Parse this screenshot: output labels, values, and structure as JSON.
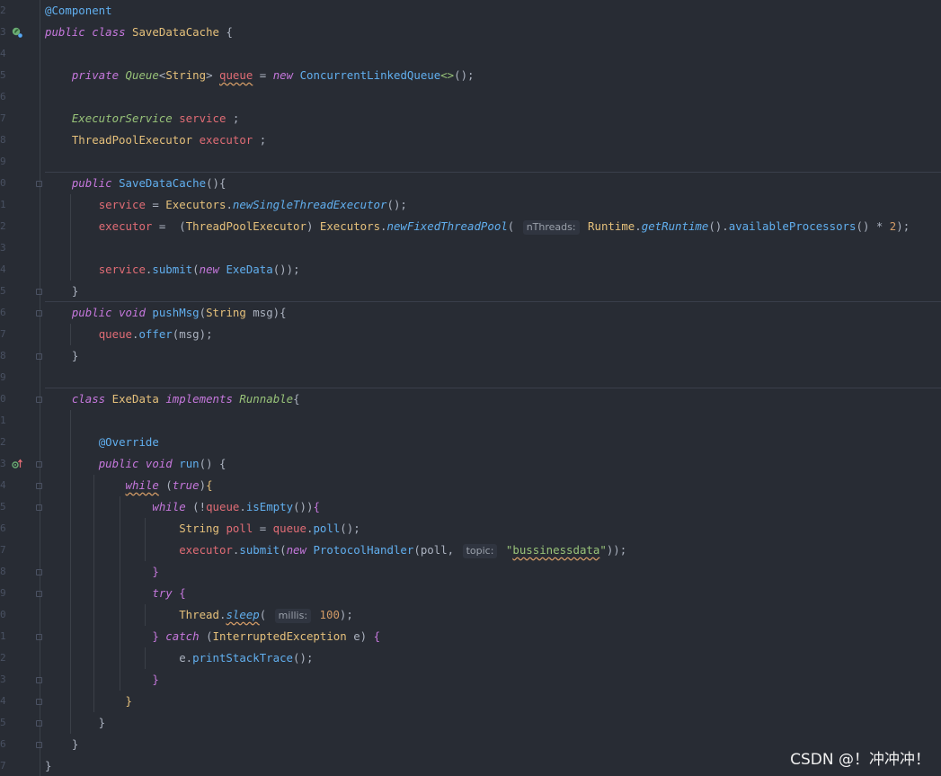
{
  "editor": {
    "line_numbers": [
      "2",
      "3",
      "4",
      "5",
      "6",
      "7",
      "8",
      "9",
      "0",
      "1",
      "2",
      "3",
      "4",
      "5",
      "6",
      "7",
      "8",
      "9",
      "0",
      "1",
      "2",
      "3",
      "4",
      "5",
      "6",
      "7",
      "8",
      "9",
      "0",
      "1",
      "2",
      "3",
      "4",
      "5",
      "6",
      "7"
    ],
    "lines": [
      [
        {
          "t": "@Component",
          "c": "ann"
        }
      ],
      [
        {
          "t": "public",
          "c": "kw"
        },
        {
          "t": " "
        },
        {
          "t": "class",
          "c": "kw"
        },
        {
          "t": " "
        },
        {
          "t": "SaveDataCache",
          "c": "cls"
        },
        {
          "t": " "
        },
        {
          "t": "{",
          "c": "punc"
        }
      ],
      [],
      [
        {
          "t": "    "
        },
        {
          "t": "private",
          "c": "kw"
        },
        {
          "t": " "
        },
        {
          "t": "Queue",
          "c": "itype"
        },
        {
          "t": "<"
        },
        {
          "t": "String",
          "c": "cls"
        },
        {
          "t": "> "
        },
        {
          "t": "queue",
          "c": "fldw"
        },
        {
          "t": " = "
        },
        {
          "t": "new",
          "c": "kw"
        },
        {
          "t": " "
        },
        {
          "t": "ConcurrentLinkedQueue",
          "c": "fn"
        },
        {
          "t": "<>",
          "c": "str"
        },
        {
          "t": "();"
        }
      ],
      [],
      [
        {
          "t": "    "
        },
        {
          "t": "ExecutorService",
          "c": "itype"
        },
        {
          "t": " "
        },
        {
          "t": "service",
          "c": "fld"
        },
        {
          "t": " ;"
        }
      ],
      [
        {
          "t": "    "
        },
        {
          "t": "ThreadPoolExecutor",
          "c": "cls"
        },
        {
          "t": " "
        },
        {
          "t": "executor",
          "c": "fld"
        },
        {
          "t": " ;"
        }
      ],
      [],
      [
        {
          "t": "    "
        },
        {
          "t": "public",
          "c": "kw"
        },
        {
          "t": " "
        },
        {
          "t": "SaveDataCache",
          "c": "fn"
        },
        {
          "t": "(){"
        }
      ],
      [
        {
          "t": "        "
        },
        {
          "t": "service",
          "c": "fld"
        },
        {
          "t": " = "
        },
        {
          "t": "Executors",
          "c": "cls"
        },
        {
          "t": "."
        },
        {
          "t": "newSingleThreadExecutor",
          "c": "sfn"
        },
        {
          "t": "();"
        }
      ],
      [
        {
          "t": "        "
        },
        {
          "t": "executor",
          "c": "fld"
        },
        {
          "t": " =  ("
        },
        {
          "t": "ThreadPoolExecutor",
          "c": "cls"
        },
        {
          "t": ") "
        },
        {
          "t": "Executors",
          "c": "cls"
        },
        {
          "t": "."
        },
        {
          "t": "newFixedThreadPool",
          "c": "sfn"
        },
        {
          "t": "( "
        },
        {
          "t": "nThreads:",
          "h": 1
        },
        {
          "t": " "
        },
        {
          "t": "Runtime",
          "c": "cls"
        },
        {
          "t": "."
        },
        {
          "t": "getRuntime",
          "c": "sfn"
        },
        {
          "t": "()."
        },
        {
          "t": "availableProcessors",
          "c": "fn"
        },
        {
          "t": "() * "
        },
        {
          "t": "2",
          "c": "num"
        },
        {
          "t": ");"
        }
      ],
      [],
      [
        {
          "t": "        "
        },
        {
          "t": "service",
          "c": "fld"
        },
        {
          "t": "."
        },
        {
          "t": "submit",
          "c": "fn"
        },
        {
          "t": "("
        },
        {
          "t": "new",
          "c": "kw"
        },
        {
          "t": " "
        },
        {
          "t": "ExeData",
          "c": "fn"
        },
        {
          "t": "());"
        }
      ],
      [
        {
          "t": "    }"
        }
      ],
      [
        {
          "t": "    "
        },
        {
          "t": "public",
          "c": "kw"
        },
        {
          "t": " "
        },
        {
          "t": "void",
          "c": "kw"
        },
        {
          "t": " "
        },
        {
          "t": "pushMsg",
          "c": "fn"
        },
        {
          "t": "("
        },
        {
          "t": "String",
          "c": "cls"
        },
        {
          "t": " msg){"
        }
      ],
      [
        {
          "t": "        "
        },
        {
          "t": "queue",
          "c": "fld"
        },
        {
          "t": "."
        },
        {
          "t": "offer",
          "c": "fn"
        },
        {
          "t": "(msg);"
        }
      ],
      [
        {
          "t": "    }"
        }
      ],
      [],
      [
        {
          "t": "    "
        },
        {
          "t": "class",
          "c": "kw"
        },
        {
          "t": " "
        },
        {
          "t": "ExeData",
          "c": "cls"
        },
        {
          "t": " "
        },
        {
          "t": "implements",
          "c": "kw"
        },
        {
          "t": " "
        },
        {
          "t": "Runnable",
          "c": "itype"
        },
        {
          "t": "{"
        }
      ],
      [],
      [
        {
          "t": "        "
        },
        {
          "t": "@Override",
          "c": "ann"
        }
      ],
      [
        {
          "t": "        "
        },
        {
          "t": "public",
          "c": "kw"
        },
        {
          "t": " "
        },
        {
          "t": "void",
          "c": "kw"
        },
        {
          "t": " "
        },
        {
          "t": "run",
          "c": "fn"
        },
        {
          "t": "() {"
        }
      ],
      [
        {
          "t": "            "
        },
        {
          "t": "while",
          "c": "kw wavy"
        },
        {
          "t": " ("
        },
        {
          "t": "true",
          "c": "kw"
        },
        {
          "t": ")"
        },
        {
          "t": "{",
          "c": "br1"
        }
      ],
      [
        {
          "t": "                "
        },
        {
          "t": "while",
          "c": "kw"
        },
        {
          "t": " (!"
        },
        {
          "t": "queue",
          "c": "fld"
        },
        {
          "t": "."
        },
        {
          "t": "isEmpty",
          "c": "fn"
        },
        {
          "t": "())"
        },
        {
          "t": "{",
          "c": "br2"
        }
      ],
      [
        {
          "t": "                    "
        },
        {
          "t": "String",
          "c": "cls"
        },
        {
          "t": " "
        },
        {
          "t": "poll",
          "c": "fld"
        },
        {
          "t": " = "
        },
        {
          "t": "queue",
          "c": "fld"
        },
        {
          "t": "."
        },
        {
          "t": "poll",
          "c": "fn"
        },
        {
          "t": "();"
        }
      ],
      [
        {
          "t": "                    "
        },
        {
          "t": "executor",
          "c": "fld"
        },
        {
          "t": "."
        },
        {
          "t": "submit",
          "c": "fn"
        },
        {
          "t": "("
        },
        {
          "t": "new",
          "c": "kw"
        },
        {
          "t": " "
        },
        {
          "t": "ProtocolHandler",
          "c": "fn"
        },
        {
          "t": "(poll, "
        },
        {
          "t": "topic:",
          "h": 1
        },
        {
          "t": " "
        },
        {
          "t": "\"",
          "c": "str"
        },
        {
          "t": "bussinessdata",
          "c": "strw"
        },
        {
          "t": "\"",
          "c": "str"
        },
        {
          "t": "));"
        }
      ],
      [
        {
          "t": "                "
        },
        {
          "t": "}",
          "c": "br2"
        }
      ],
      [
        {
          "t": "                "
        },
        {
          "t": "try",
          "c": "kw"
        },
        {
          "t": " "
        },
        {
          "t": "{",
          "c": "br2"
        }
      ],
      [
        {
          "t": "                    "
        },
        {
          "t": "Thread",
          "c": "cls"
        },
        {
          "t": "."
        },
        {
          "t": "sleep",
          "c": "sfnw"
        },
        {
          "t": "( "
        },
        {
          "t": "millis:",
          "h": 1
        },
        {
          "t": " "
        },
        {
          "t": "100",
          "c": "num"
        },
        {
          "t": ");"
        }
      ],
      [
        {
          "t": "                "
        },
        {
          "t": "}",
          "c": "br2"
        },
        {
          "t": " "
        },
        {
          "t": "catch",
          "c": "kw"
        },
        {
          "t": " ("
        },
        {
          "t": "InterruptedException",
          "c": "cls"
        },
        {
          "t": " e) "
        },
        {
          "t": "{",
          "c": "br2"
        }
      ],
      [
        {
          "t": "                    e."
        },
        {
          "t": "printStackTrace",
          "c": "fn"
        },
        {
          "t": "();"
        }
      ],
      [
        {
          "t": "                "
        },
        {
          "t": "}",
          "c": "br2"
        }
      ],
      [
        {
          "t": "            "
        },
        {
          "t": "}",
          "c": "br1"
        }
      ],
      [
        {
          "t": "        }"
        }
      ],
      [
        {
          "t": "    }"
        }
      ],
      [
        {
          "t": "}"
        }
      ]
    ]
  },
  "watermark": "CSDN @！冲冲冲！",
  "colors": {
    "background": "#282c34",
    "keyword": "#c678dd",
    "type": "#e5c07b",
    "field": "#e06c75",
    "method": "#61afef",
    "string": "#98c379",
    "number": "#d19a66"
  },
  "icons": {
    "class_gutter": "spring-bean-icon",
    "override_gutter": "override-arrow-icon"
  }
}
